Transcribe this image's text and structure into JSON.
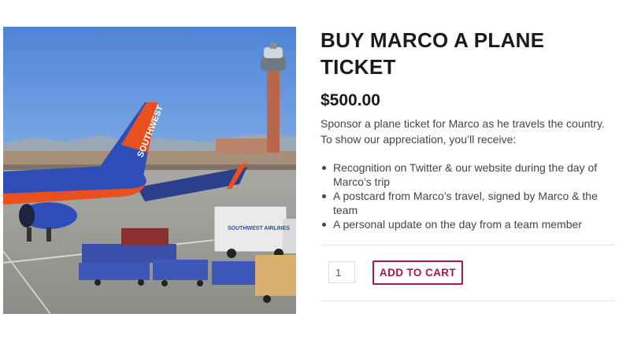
{
  "product": {
    "title": "BUY MARCO A PLANE TICKET",
    "price": "$500.00",
    "description": "Sponsor a plane ticket for Marco as he travels the country. To show our appreciation, you’ll receive:",
    "perks": [
      "Recognition on Twitter & our website during the day of Marco’s trip",
      "A postcard from Marco’s travel, signed by Marco & the team",
      "A personal update on the day from a team member"
    ],
    "quantity": "1",
    "add_to_cart_label": "ADD TO CART"
  },
  "image": {
    "plane_livery_text": "SOUTHWEST",
    "truck_text": "SOUTHWEST AIRLINES"
  },
  "colors": {
    "accent": "#a41c3a",
    "sky": "#5a8fd8",
    "plane_blue": "#2e4db8",
    "plane_orange": "#e8501e"
  }
}
